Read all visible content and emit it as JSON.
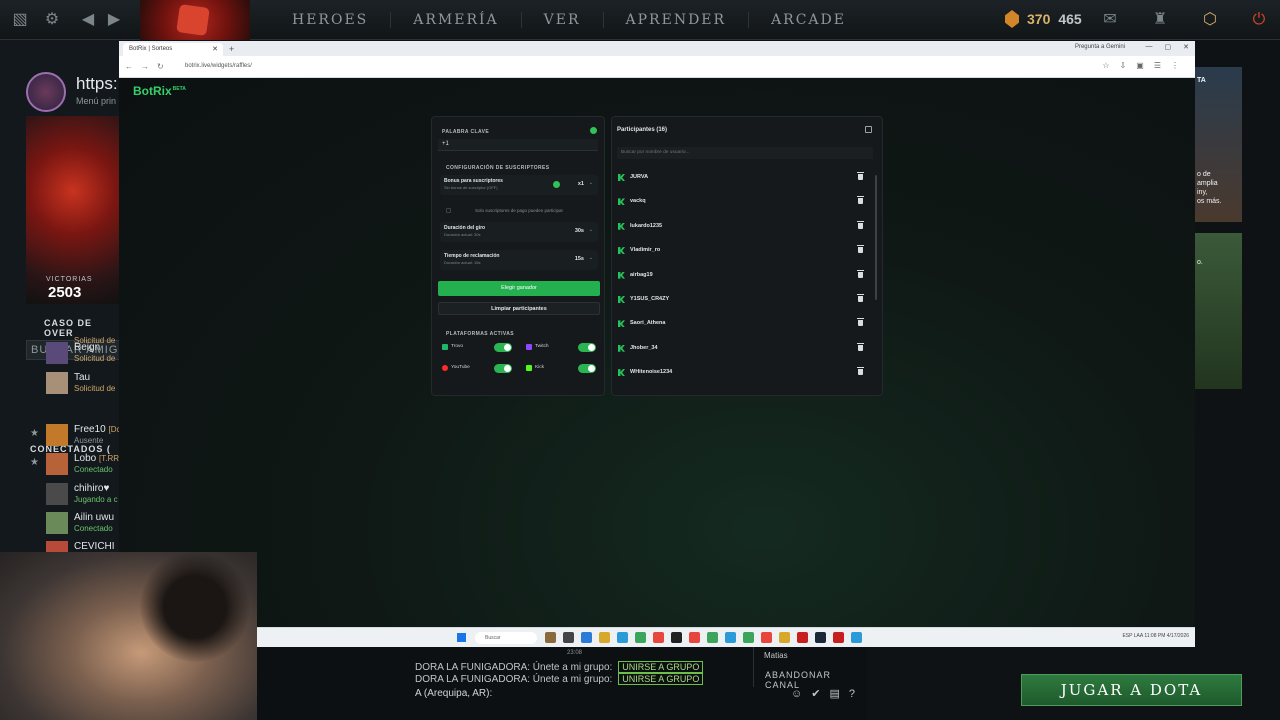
{
  "dota": {
    "nav": [
      "HEROES",
      "ARMERÍA",
      "VER",
      "APRENDER",
      "ARCADE"
    ],
    "shards": "370",
    "plus": "465",
    "profile_url": "https:",
    "profile_menu": "Menú prin",
    "victorias_label": "VICTORIAS",
    "victorias": "2503",
    "caso": "CASO DE OVER",
    "buscar_amigos": "BUSCAR AMIGOS",
    "friends_top": [
      {
        "name": "",
        "status": "Solicitud de"
      },
      {
        "name": "Reign",
        "status": "Solicitud de"
      },
      {
        "name": "Tau",
        "status": "Solicitud de"
      }
    ],
    "conectados": "CONECTADOS (",
    "friends": [
      {
        "name": "Free10",
        "tag": "[Dc",
        "status": "Ausente"
      },
      {
        "name": "Lobo",
        "tag": "[T.RR",
        "status": "Conectado"
      },
      {
        "name": "chihiro♥",
        "tag": "",
        "status": "Jugando a c"
      },
      {
        "name": "Ailin uwu",
        "tag": "",
        "status": "Conectado"
      },
      {
        "name": "CEVICHI",
        "tag": "",
        "status": ""
      }
    ],
    "right_text1": "TA",
    "right_text2": "o de\namplia\niny,\nos más.",
    "right_text3": "o.",
    "play_button": "JUGAR A DOTA",
    "chat": {
      "time": "23:08",
      "lines": [
        {
          "text": "DORA LA FUNIGADORA: Únete a mi grupo:",
          "button": "UNIRSE A GRUPO"
        },
        {
          "text": "DORA LA FUNIGADORA: Únete a mi grupo:",
          "button": "UNIRSE A GRUPO"
        }
      ],
      "input": "A (Arequipa, AR):",
      "side_name": "Matias",
      "abandon": "ABANDONAR CANAL"
    }
  },
  "browser": {
    "tab_title": "BotRix | Sorteos",
    "gemini": "Pregunta a Gemini",
    "url": "botrix.live/widgets/raffles/"
  },
  "botrix": {
    "logo": "BotRix",
    "beta": "BETA",
    "keyword_label": "PALABRA CLAVE",
    "keyword_value": "+1",
    "subs_config_label": "CONFIGURACIÓN DE SUSCRIPTORES",
    "subs_bonus_title": "Bonus para suscriptores",
    "subs_bonus_sub": "Sin bonus de suscriptor (OFF)",
    "subs_bonus_value": "x1",
    "only_subs": "Solo suscriptores de pago pueden participar",
    "spin_title": "Duración del giro",
    "spin_sub": "Duración actual: 30s",
    "spin_value": "30s",
    "claim_title": "Tiempo de reclamación",
    "claim_sub": "Duración actual: 15s",
    "claim_value": "15s",
    "pick_winner": "Elegir ganador",
    "clear_participants": "Limpiar participantes",
    "platforms_label": "PLATAFORMAS ACTIVAS",
    "platforms": [
      {
        "name": "Trovo",
        "color": "#1fb86a"
      },
      {
        "name": "Twitch",
        "color": "#9146ff"
      },
      {
        "name": "YouTube",
        "color": "#ff2b2b"
      },
      {
        "name": "Kick",
        "color": "#53fc18"
      }
    ],
    "participants_title": "Participantes (16)",
    "search_placeholder": "Buscar por nombre de usuario...",
    "participants": [
      "JURVA",
      "vackq",
      "lukardo1235",
      "Vladimir_ro",
      "airbag19",
      "Y1SUS_CR4ZY",
      "Saori_Athena",
      "Jhober_34",
      "WHitenoise1234"
    ]
  },
  "taskbar": {
    "search": "Buscar",
    "tray": "ESP LAA  11:08 PM  4/17/2026"
  }
}
